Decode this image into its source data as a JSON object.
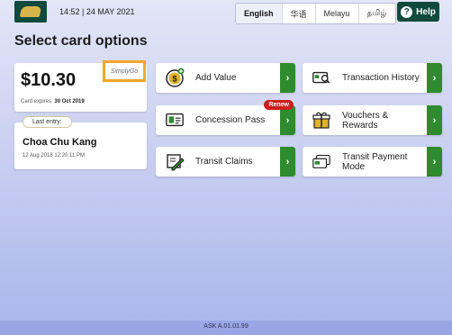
{
  "header": {
    "datetime": "14:52 | 24 MAY 2021",
    "languages": [
      "English",
      "华语",
      "Melayu",
      "தமிழ்"
    ],
    "selected_language": "English",
    "help_label": "Help"
  },
  "page_title": "Select card options",
  "card": {
    "balance": "$10.30",
    "brand": "SimplyGo",
    "expiry_label": "Card expires:",
    "expiry_value": "30 Oct 2019"
  },
  "last_entry": {
    "tag": "Last entry:",
    "station": "Choa Chu Kang",
    "time": "12 Aug 2018 12:20:11 PM"
  },
  "options": [
    {
      "label": "Add Value",
      "icon": "dollar-coin-icon"
    },
    {
      "label": "Transaction History",
      "icon": "magnifier-card-icon"
    },
    {
      "label": "Concession Pass",
      "icon": "id-card-icon",
      "badge": "Renew"
    },
    {
      "label": "Vouchers & Rewards",
      "icon": "gift-icon"
    },
    {
      "label": "Transit Claims",
      "icon": "claim-pen-icon"
    },
    {
      "label": "Transit Payment Mode",
      "icon": "payment-card-icon"
    }
  ],
  "footer": {
    "version": "ASK A.01.01.99"
  },
  "colors": {
    "brand_green": "#0f4a3c",
    "arrow_green": "#2e8b2e",
    "highlight": "#f4a62a",
    "badge_red": "#c8201c"
  }
}
